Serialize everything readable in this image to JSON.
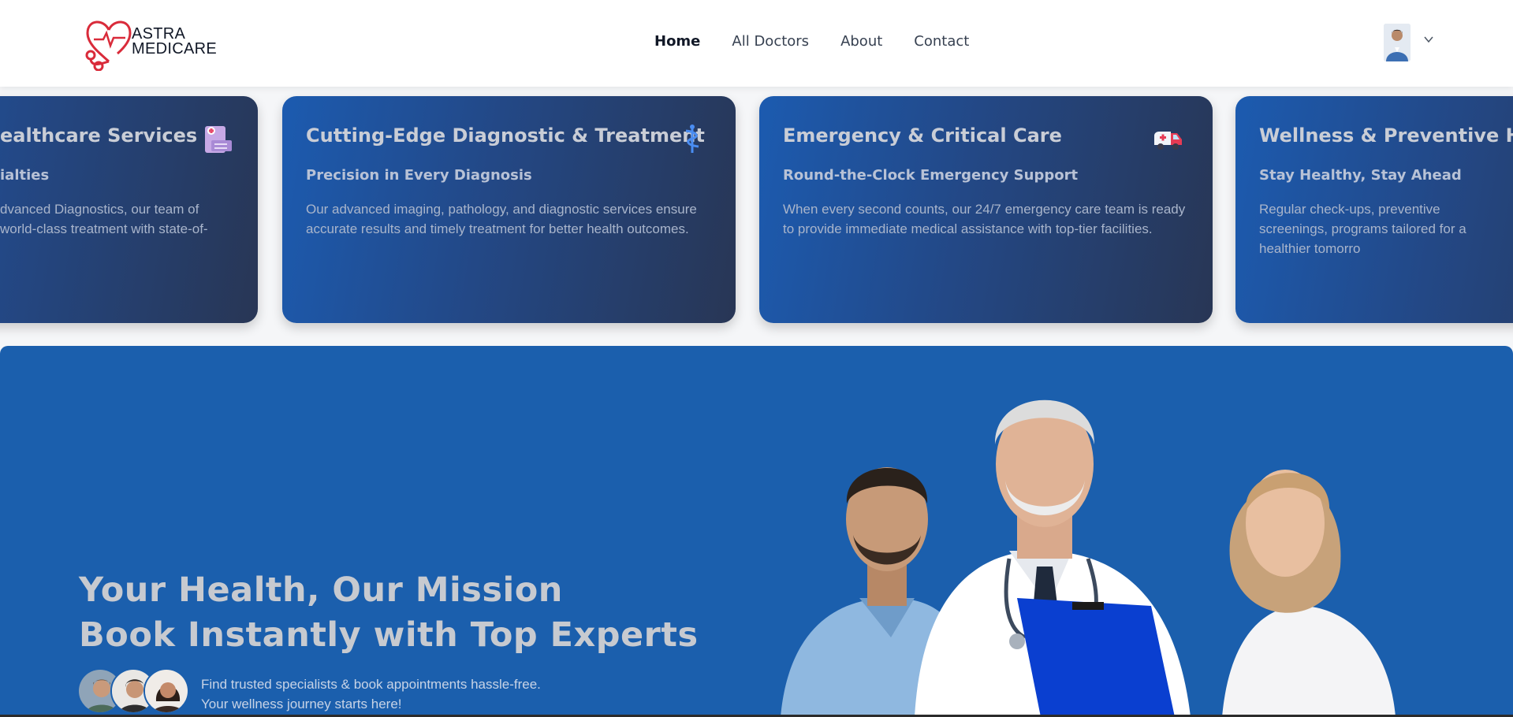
{
  "brand": {
    "line1": "ASTRA",
    "line2": "MEDICARE",
    "logo_icon": "heart-stethoscope-icon",
    "accent_color": "#d92b3a"
  },
  "nav": {
    "links": [
      "Home",
      "All Doctors",
      "About",
      "Contact"
    ],
    "active": "Home"
  },
  "profile": {
    "avatar_icon": "user-avatar",
    "menu_icon": "chevron-down-icon"
  },
  "cards": [
    {
      "title": "ealthcare Services",
      "subtitle": "ialties",
      "desc": "dvanced Diagnostics, our team of  world-class treatment with state-of-",
      "icon": "hospital-building-icon"
    },
    {
      "title": "Cutting-Edge Diagnostic & Treatment",
      "subtitle": "Precision in Every Diagnosis",
      "desc": "Our advanced imaging, pathology, and diagnostic services ensure accurate results and timely treatment for better health outcomes.",
      "icon": "caduceus-icon"
    },
    {
      "title": "Emergency & Critical Care",
      "subtitle": "Round-the-Clock Emergency Support",
      "desc": "When every second counts, our 24/7 emergency care team is ready to provide immediate medical assistance with top-tier facilities.",
      "icon": "ambulance-icon"
    },
    {
      "title": "Wellness & Preventive Heal",
      "subtitle": "Stay Healthy, Stay Ahead",
      "desc": "Regular check-ups, preventive screenings, programs tailored for a healthier tomorro",
      "icon": "wellness-icon"
    }
  ],
  "hero": {
    "title_line1": "Your Health, Our Mission",
    "title_line2": "Book Instantly with Top Experts",
    "text_line1": "Find trusted specialists & book appointments hassle-free.",
    "text_line2": "Your wellness journey starts here!",
    "background_color": "#1b5fad"
  }
}
